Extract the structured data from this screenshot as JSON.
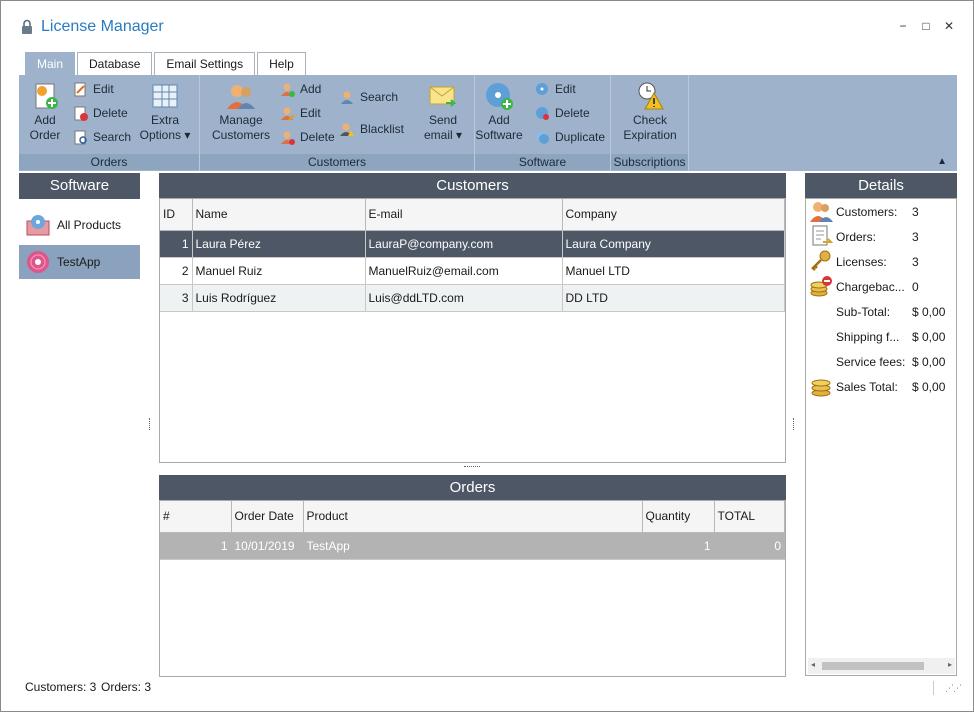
{
  "window": {
    "title": "License Manager",
    "minimize": "−",
    "maximize": "□",
    "close": "✕"
  },
  "tabs": [
    "Main",
    "Database",
    "Email Settings",
    "Help"
  ],
  "ribbon": {
    "orders": {
      "label": "Orders",
      "add_order": [
        "Add",
        "Order"
      ],
      "edit": "Edit",
      "delete": "Delete",
      "search": "Search",
      "extra_options": [
        "Extra",
        "Options ▾"
      ]
    },
    "customers": {
      "label": "Customers",
      "manage": [
        "Manage",
        "Customers"
      ],
      "add": "Add",
      "edit": "Edit",
      "delete": "Delete",
      "search": "Search",
      "blacklist": "Blacklist",
      "send_email": [
        "Send",
        "email ▾"
      ]
    },
    "software": {
      "label": "Software",
      "add": [
        "Add",
        "Software"
      ],
      "edit": "Edit",
      "delete": "Delete",
      "duplicate": "Duplicate"
    },
    "subscriptions": {
      "label": "Subscriptions",
      "check": [
        "Check",
        "Expiration"
      ]
    }
  },
  "software_pane": {
    "header": "Software",
    "items": [
      {
        "label": "All Products",
        "icon": "box-disc-icon"
      },
      {
        "label": "TestApp",
        "icon": "pink-disc-icon"
      }
    ]
  },
  "customers_pane": {
    "header": "Customers",
    "columns": [
      "ID",
      "Name",
      "E-mail",
      "Company"
    ],
    "rows": [
      {
        "id": "1",
        "name": "Laura Pérez",
        "email": "LauraP@company.com",
        "company": "Laura Company"
      },
      {
        "id": "2",
        "name": "Manuel Ruiz",
        "email": "ManuelRuiz@email.com",
        "company": "Manuel LTD"
      },
      {
        "id": "3",
        "name": "Luis Rodríguez",
        "email": "Luis@ddLTD.com",
        "company": "DD LTD"
      }
    ]
  },
  "orders_pane": {
    "header": "Orders",
    "columns": [
      "#",
      "Order Date",
      "Product",
      "Quantity",
      "TOTAL"
    ],
    "rows": [
      {
        "num": "1",
        "date": "10/01/2019",
        "product": "TestApp",
        "quantity": "1",
        "total": "0"
      }
    ]
  },
  "details_pane": {
    "header": "Details",
    "rows": [
      {
        "label": "Customers:",
        "value": "3",
        "icon": "customers-icon"
      },
      {
        "label": "Orders:",
        "value": "3",
        "icon": "orders-icon"
      },
      {
        "label": "Licenses:",
        "value": "3",
        "icon": "key-icon"
      },
      {
        "label": "Chargebac...",
        "value": "0",
        "icon": "chargeback-coins-icon"
      },
      {
        "label": "Sub-Total:",
        "value": "$ 0,00",
        "icon": ""
      },
      {
        "label": "Shipping f...",
        "value": "$ 0,00",
        "icon": ""
      },
      {
        "label": "Service fees:",
        "value": "$ 0,00",
        "icon": ""
      },
      {
        "label": "Sales Total:",
        "value": "$ 0,00",
        "icon": "coins-icon"
      }
    ]
  },
  "status": {
    "customers": "Customers: 3",
    "orders": "Orders: 3"
  },
  "colors": {
    "accent": "#2a7ac0",
    "ribbon": "#9eb3cb",
    "header": "#4d5766"
  }
}
